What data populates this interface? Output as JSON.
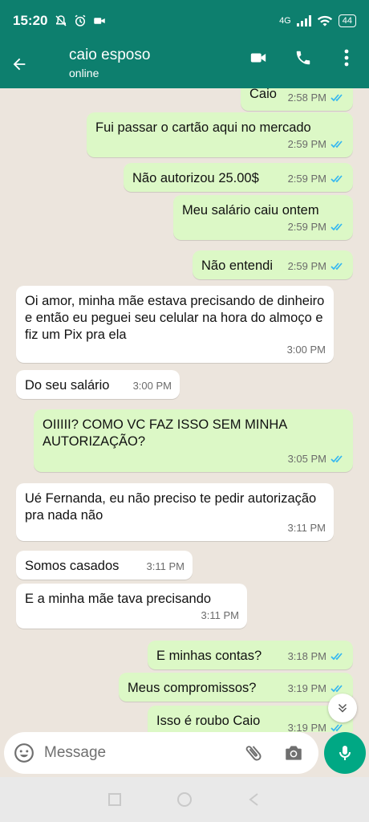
{
  "status_bar": {
    "time": "15:20",
    "network": "4G",
    "battery": "44"
  },
  "header": {
    "contact_name": "caio esposo",
    "status": "online"
  },
  "messages": [
    {
      "dir": "out",
      "text": "Caio",
      "time": "2:58 PM",
      "ticks": true
    },
    {
      "dir": "out",
      "text": "Fui passar o cartão aqui no mercado",
      "time": "2:59 PM",
      "ticks": true
    },
    {
      "dir": "out",
      "text": "Não autorizou 25.00$",
      "time": "2:59 PM",
      "ticks": true
    },
    {
      "dir": "out",
      "text": "Meu salário caiu ontem",
      "time": "2:59 PM",
      "ticks": true
    },
    {
      "dir": "out",
      "text": "Não entendi",
      "time": "2:59 PM",
      "ticks": true
    },
    {
      "dir": "in",
      "text": "Oi amor, minha mãe estava precisando de dinheiro e então eu peguei seu celular na hora do almoço e fiz um Pix pra ela",
      "time": "3:00 PM"
    },
    {
      "dir": "in",
      "text": "Do seu salário",
      "time": "3:00 PM"
    },
    {
      "dir": "out",
      "text": "OIIIII? COMO VC FAZ ISSO SEM MINHA AUTORIZAÇÃO?",
      "time": "3:05 PM",
      "ticks": true
    },
    {
      "dir": "in",
      "text": "Ué Fernanda, eu não preciso te pedir autorização pra nada não",
      "time": "3:11 PM"
    },
    {
      "dir": "in",
      "text": "Somos casados",
      "time": "3:11 PM"
    },
    {
      "dir": "in",
      "text": "E a minha mãe tava precisando",
      "time": "3:11 PM"
    },
    {
      "dir": "out",
      "text": "E minhas contas?",
      "time": "3:18 PM",
      "ticks": true
    },
    {
      "dir": "out",
      "text": "Meus compromissos?",
      "time": "3:19 PM",
      "ticks": true
    },
    {
      "dir": "out",
      "text": "Isso é roubo Caio",
      "time": "3:19 PM",
      "ticks": true
    }
  ],
  "composer": {
    "placeholder": "Message"
  },
  "icons": [
    "back-arrow-icon",
    "video-call-icon",
    "phone-icon",
    "more-vert-icon",
    "emoji-icon",
    "attach-icon",
    "camera-icon",
    "mic-icon",
    "chevron-down-icon"
  ],
  "colors": {
    "header": "#0d7f6e",
    "outgoing_bubble": "#dcf8c6",
    "incoming_bubble": "#ffffff",
    "tick_blue": "#34b7f1",
    "mic_button": "#00a884"
  }
}
